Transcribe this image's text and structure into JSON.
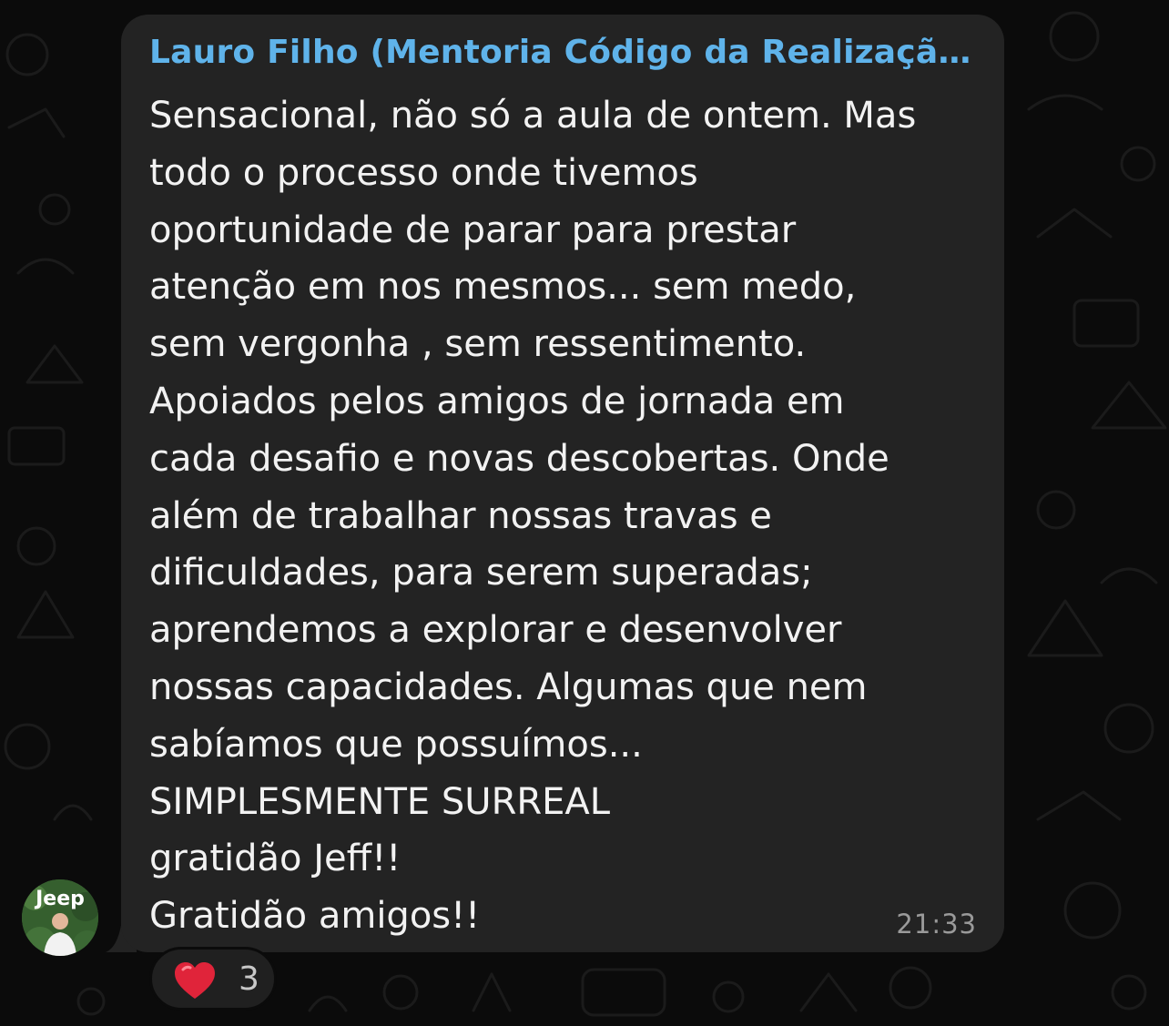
{
  "message": {
    "sender": "Lauro Filho (Mentoria Código da Realização...",
    "lines": [
      "Sensacional, não só a aula de ontem. Mas",
      "todo o processo onde tivemos",
      "oportunidade de parar para prestar",
      "atenção em nos mesmos... sem medo,",
      "sem vergonha , sem ressentimento.",
      "Apoiados pelos amigos de jornada em",
      "cada desafio e novas descobertas. Onde",
      "além de trabalhar nossas travas e",
      "dificuldades, para serem superadas;",
      "aprendemos a explorar e desenvolver",
      "nossas capacidades. Algumas que nem",
      "sabíamos que possuímos...",
      "SIMPLESMENTE SURREAL",
      "gratidão Jeff!!",
      "Gratidão amigos!!"
    ],
    "time": "21:33"
  },
  "avatar": {
    "text": "Jeep"
  },
  "reaction": {
    "icon": "heart-icon",
    "count": "3",
    "color": "#e0243a"
  },
  "colors": {
    "background": "#0b0b0b",
    "bubble": "#232323",
    "sender": "#5fb3ea",
    "text": "#f2f2f2",
    "time": "#9a9a9a"
  }
}
